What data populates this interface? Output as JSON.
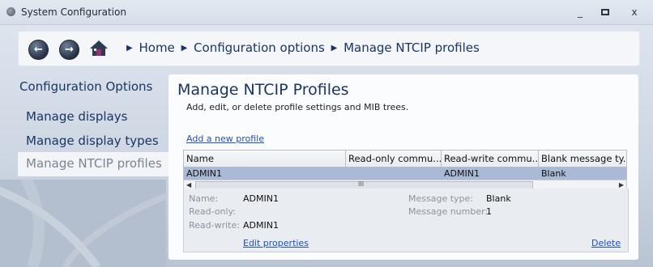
{
  "window": {
    "title": "System Configuration",
    "minimize": "_",
    "maximize": "▫",
    "close": "x"
  },
  "nav": {
    "back_icon": "back-arrow-icon",
    "forward_icon": "forward-arrow-icon",
    "home_icon": "home-icon",
    "breadcrumb": [
      "Home",
      "Configuration options",
      "Manage NTCIP profiles"
    ]
  },
  "sidebar": {
    "heading": "Configuration Options",
    "items": [
      {
        "label": "Manage displays",
        "selected": false
      },
      {
        "label": "Manage display types",
        "selected": false
      },
      {
        "label": "Manage NTCIP profiles",
        "selected": true
      }
    ]
  },
  "main": {
    "title": "Manage NTCIP Profiles",
    "subtitle": "Add, edit, or delete profile settings and MIB trees.",
    "add_link": "Add a new profile",
    "table": {
      "columns": [
        "Name",
        "Read-only commu...",
        "Read-write commu...",
        "Blank message ty..."
      ],
      "rows": [
        [
          "ADMIN1",
          "",
          "ADMIN1",
          "Blank"
        ]
      ],
      "scroll_grip": "III"
    },
    "details": {
      "name_label": "Name:",
      "name_value": "ADMIN1",
      "readonly_label": "Read-only:",
      "readonly_value": "",
      "readwrite_label": "Read-write:",
      "readwrite_value": "ADMIN1",
      "msgtype_label": "Message type:",
      "msgtype_value": "Blank",
      "msgnum_label": "Message number:",
      "msgnum_value": "1",
      "edit_link": "Edit properties",
      "delete_link": "Delete"
    }
  },
  "colors": {
    "accent": "#1a3564",
    "link": "#1e4fc4",
    "selected_row": "#a9b9d6"
  }
}
